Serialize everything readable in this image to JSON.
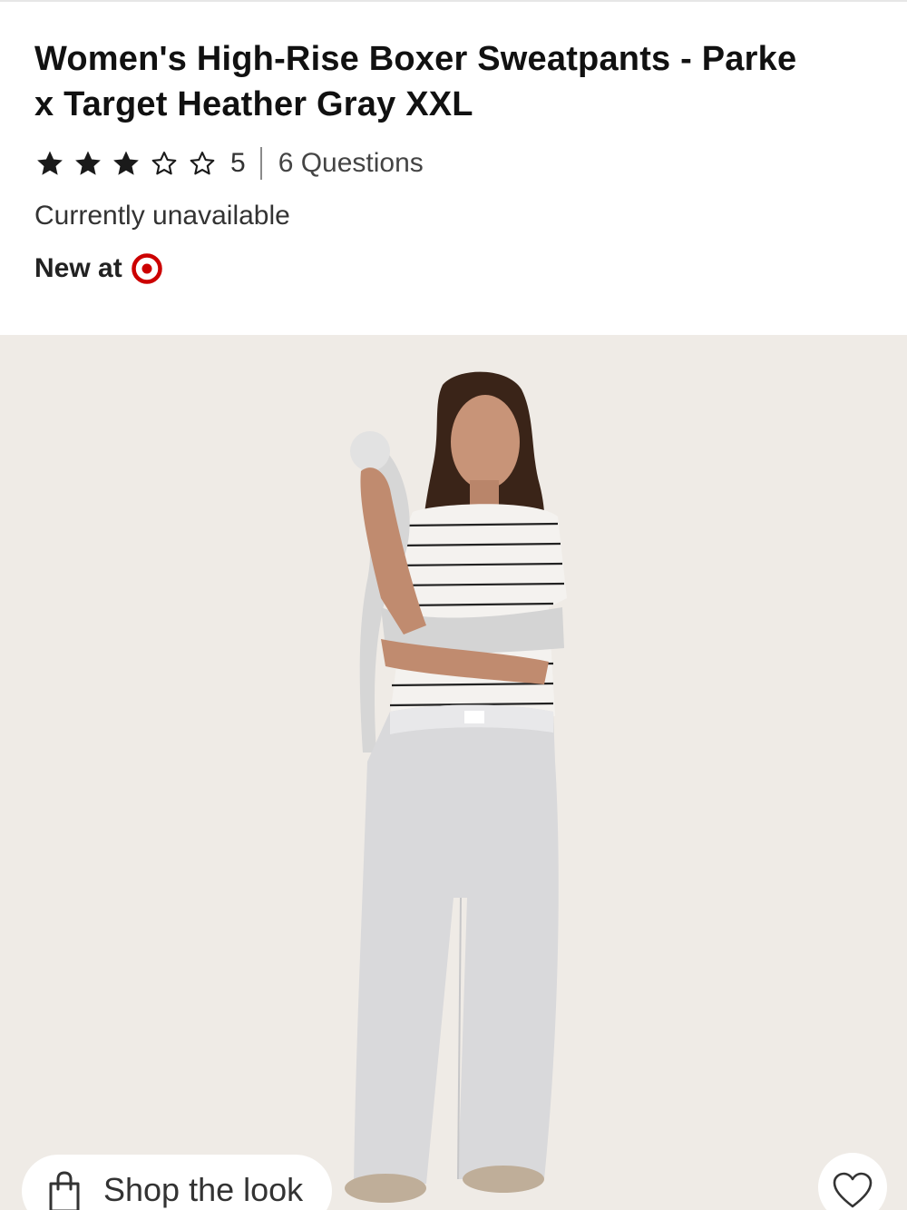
{
  "product": {
    "title_line1": "Women's High-Rise Boxer Sweatpants - Parke",
    "title_line2": "x Target Heather Gray XXL",
    "rating": {
      "value": 3,
      "max": 5,
      "count": "5"
    },
    "questions_label": "6 Questions",
    "availability": "Currently unavailable",
    "new_at_label": "New at"
  },
  "icons": {
    "star_filled": "star-filled-icon",
    "star_empty": "star-outline-icon",
    "brand_logo": "target-bullseye-icon",
    "shopping_bag": "shopping-bag-icon",
    "favorite": "heart-outline-icon"
  },
  "hero": {
    "alt": "Model wearing heather gray boxer sweatpants and striped tee"
  },
  "shop_the_look": {
    "label": "Shop the look"
  },
  "colors": {
    "brand_red": "#cc0000",
    "hero_background": "#efebe6",
    "text_primary": "#111111"
  }
}
